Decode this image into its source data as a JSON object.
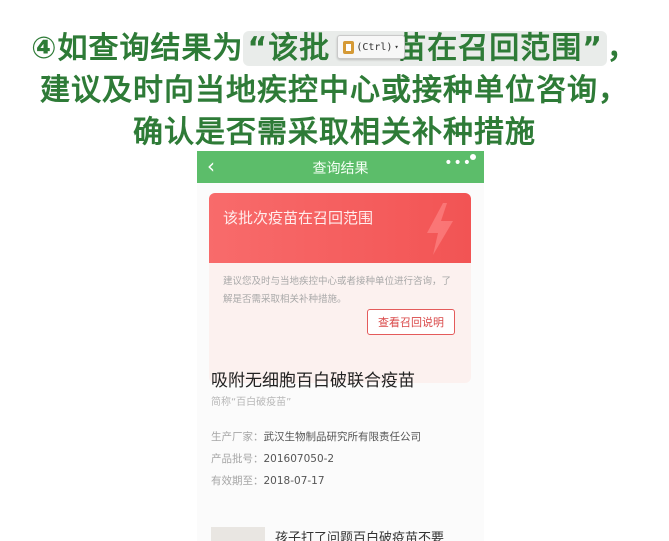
{
  "caption": {
    "line1_prefix": "④如查询结果为",
    "line1_quote_a": "“该批",
    "line1_quote_b": "苗在召回范围”",
    "line1_suffix": "，",
    "line2": "建议及时向当地疾控中心或接种单位咨询，",
    "line3": "确认是否需采取相关补种措施"
  },
  "ctrl_badge": {
    "label": "(Ctrl)",
    "icon": "paste-clipboard-icon"
  },
  "appbar": {
    "back_icon": "chevron-left-icon",
    "title": "查询结果",
    "more_icon": "more-dots-icon",
    "accent_color": "#5cbd6a"
  },
  "alert": {
    "title": "该批次疫苗在召回范围",
    "icon": "lightning-bolt-icon",
    "description": "建议您及时与当地疾控中心或者接种单位进行咨询，了解是否需采取相关补种措施。",
    "button": "查看召回说明",
    "color": "#f25454"
  },
  "vaccine": {
    "name": "吸附无细胞百白破联合疫苗",
    "alias": "简称“百白破疫苗”",
    "manufacturer_label": "生产厂家：",
    "manufacturer": "武汉生物制品研究所有限责任公司",
    "batch_label": "产品批号：",
    "batch": "201607050-2",
    "expiry_label": "有效期至：",
    "expiry": "2018-07-17"
  },
  "related": {
    "title": "孩子打了问题百白破疫苗不要"
  }
}
